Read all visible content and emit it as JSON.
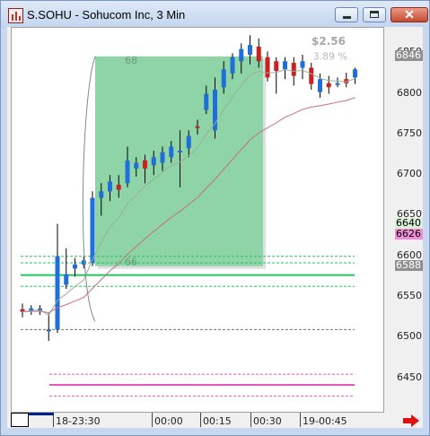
{
  "window": {
    "title": "S.SOHU - Sohucom Inc, 3 Min",
    "colors": {
      "titlebar": "#c6d7ee",
      "close_button": "#c44b33"
    }
  },
  "chart_data": {
    "type": "candlestick",
    "y_range": [
      6420,
      6880
    ],
    "price_ticks": [
      "6850",
      "6800",
      "6750",
      "6700",
      "6650",
      "6600",
      "6550",
      "6500",
      "6450"
    ],
    "time_ticks": [
      "18-23:30",
      "00:00",
      "00:15",
      "00:30",
      "19-00:45"
    ],
    "last_price": "6846",
    "price_tags": [
      {
        "value": "6846",
        "y": 6846,
        "bg": "#909090",
        "fg": "#ffffff"
      },
      {
        "value": "6640",
        "y": 6640,
        "bg": "#d8f0d8",
        "fg": "#000000"
      },
      {
        "value": "6626",
        "y": 6626,
        "bg": "#f08cd8",
        "fg": "#000000"
      },
      {
        "value": "6588",
        "y": 6588,
        "bg": "#909090",
        "fg": "#ffffff"
      }
    ],
    "change_label": "$2.56",
    "change_pct_label": "3.89 %",
    "box": {
      "top_label": "68",
      "bottom_label": "66",
      "y_top": 6846,
      "y_bottom": 6588,
      "color": "#8fd4a6"
    },
    "candles": [
      {
        "o": 6535,
        "h": 6542,
        "l": 6525,
        "c": 6532,
        "color": "red"
      },
      {
        "o": 6533,
        "h": 6540,
        "l": 6528,
        "c": 6536,
        "color": "blue"
      },
      {
        "o": 6532,
        "h": 6540,
        "l": 6528,
        "c": 6536,
        "color": "blue"
      },
      {
        "o": 6510,
        "h": 6530,
        "l": 6496,
        "c": 6510,
        "color": "blue"
      },
      {
        "o": 6510,
        "h": 6640,
        "l": 6506,
        "c": 6600,
        "color": "blue"
      },
      {
        "o": 6565,
        "h": 6610,
        "l": 6560,
        "c": 6578,
        "color": "blue"
      },
      {
        "o": 6585,
        "h": 6598,
        "l": 6575,
        "c": 6590,
        "color": "blue"
      },
      {
        "o": 6590,
        "h": 6600,
        "l": 6585,
        "c": 6595,
        "color": "blue"
      },
      {
        "o": 6592,
        "h": 6680,
        "l": 6588,
        "c": 6672,
        "color": "blue"
      },
      {
        "o": 6672,
        "h": 6690,
        "l": 6650,
        "c": 6680,
        "color": "blue"
      },
      {
        "o": 6680,
        "h": 6700,
        "l": 6668,
        "c": 6692,
        "color": "blue"
      },
      {
        "o": 6688,
        "h": 6700,
        "l": 6672,
        "c": 6682,
        "color": "red"
      },
      {
        "o": 6690,
        "h": 6735,
        "l": 6685,
        "c": 6718,
        "color": "blue"
      },
      {
        "o": 6715,
        "h": 6722,
        "l": 6698,
        "c": 6708,
        "color": "blue"
      },
      {
        "o": 6708,
        "h": 6725,
        "l": 6690,
        "c": 6718,
        "color": "red"
      },
      {
        "o": 6712,
        "h": 6730,
        "l": 6700,
        "c": 6722,
        "color": "blue"
      },
      {
        "o": 6715,
        "h": 6735,
        "l": 6705,
        "c": 6728,
        "color": "blue"
      },
      {
        "o": 6722,
        "h": 6742,
        "l": 6715,
        "c": 6735,
        "color": "blue"
      },
      {
        "o": 6730,
        "h": 6755,
        "l": 6685,
        "c": 6730,
        "color": "blue"
      },
      {
        "o": 6733,
        "h": 6755,
        "l": 6722,
        "c": 6748,
        "color": "blue"
      },
      {
        "o": 6760,
        "h": 6768,
        "l": 6750,
        "c": 6760,
        "color": "red"
      },
      {
        "o": 6780,
        "h": 6810,
        "l": 6775,
        "c": 6800,
        "color": "blue"
      },
      {
        "o": 6755,
        "h": 6820,
        "l": 6745,
        "c": 6805,
        "color": "blue"
      },
      {
        "o": 6808,
        "h": 6840,
        "l": 6800,
        "c": 6830,
        "color": "blue"
      },
      {
        "o": 6825,
        "h": 6850,
        "l": 6818,
        "c": 6845,
        "color": "blue"
      },
      {
        "o": 6840,
        "h": 6862,
        "l": 6825,
        "c": 6855,
        "color": "blue"
      },
      {
        "o": 6848,
        "h": 6872,
        "l": 6836,
        "c": 6860,
        "color": "blue"
      },
      {
        "o": 6858,
        "h": 6868,
        "l": 6832,
        "c": 6840,
        "color": "red"
      },
      {
        "o": 6845,
        "h": 6852,
        "l": 6815,
        "c": 6820,
        "color": "red"
      },
      {
        "o": 6840,
        "h": 6845,
        "l": 6800,
        "c": 6828,
        "color": "red"
      },
      {
        "o": 6830,
        "h": 6845,
        "l": 6818,
        "c": 6840,
        "color": "blue"
      },
      {
        "o": 6838,
        "h": 6845,
        "l": 6810,
        "c": 6822,
        "color": "red"
      },
      {
        "o": 6840,
        "h": 6848,
        "l": 6818,
        "c": 6832,
        "color": "blue"
      },
      {
        "o": 6832,
        "h": 6838,
        "l": 6805,
        "c": 6812,
        "color": "red"
      },
      {
        "o": 6818,
        "h": 6825,
        "l": 6795,
        "c": 6802,
        "color": "blue"
      },
      {
        "o": 6813,
        "h": 6822,
        "l": 6800,
        "c": 6808,
        "color": "red"
      },
      {
        "o": 6813,
        "h": 6820,
        "l": 6808,
        "c": 6813,
        "color": "blue"
      },
      {
        "o": 6818,
        "h": 6826,
        "l": 6808,
        "c": 6813,
        "color": "red"
      },
      {
        "o": 6820,
        "h": 6832,
        "l": 6812,
        "c": 6830,
        "color": "blue"
      }
    ],
    "horizontal_lines": [
      {
        "y": 6600,
        "color": "#22c55e",
        "style": "dashed"
      },
      {
        "y": 6592,
        "color": "#22c55e",
        "style": "dashed"
      },
      {
        "y": 6577,
        "color": "#22c55e",
        "style": "solid"
      },
      {
        "y": 6563,
        "color": "#22c55e",
        "style": "dashed"
      },
      {
        "y": 6510,
        "color": "#707070",
        "style": "dashed"
      },
      {
        "y": 6455,
        "color": "#ee55bb",
        "style": "dashed"
      },
      {
        "y": 6442,
        "color": "#ee55bb",
        "style": "solid"
      },
      {
        "y": 6428,
        "color": "#ee55bb",
        "style": "dashed"
      }
    ],
    "colors": {
      "up": "#1e6fd9",
      "down": "#cc2020",
      "ma_fast": "#9ab09a",
      "ma_slow": "#c47080"
    }
  }
}
